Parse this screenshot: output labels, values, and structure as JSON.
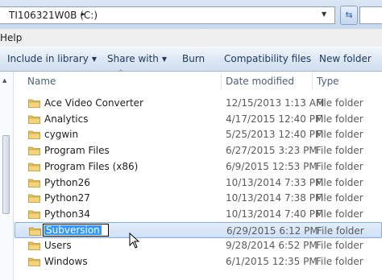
{
  "address": {
    "path": "TI106321W0B (C:)",
    "chevron": "▸"
  },
  "menubar": {
    "help": "Help"
  },
  "commands": {
    "include": "Include in library",
    "share": "Share with",
    "burn": "Burn",
    "compat": "Compatibility files",
    "newfolder": "New folder",
    "arrow": "▼"
  },
  "columns": {
    "name": "Name",
    "date": "Date modified",
    "type": "Type"
  },
  "rows": [
    {
      "name": "Ace Video Converter",
      "date": "12/15/2013 1:13 AM",
      "type": "File folder"
    },
    {
      "name": "Analytics",
      "date": "4/17/2015 12:40 PM",
      "type": "File folder"
    },
    {
      "name": "cygwin",
      "date": "5/25/2013 12:40 PM",
      "type": "File folder"
    },
    {
      "name": "Program Files",
      "date": "6/27/2015 3:23 PM",
      "type": "File folder"
    },
    {
      "name": "Program Files (x86)",
      "date": "6/9/2015 12:53 PM",
      "type": "File folder"
    },
    {
      "name": "Python26",
      "date": "10/13/2014 7:33 PM",
      "type": "File folder"
    },
    {
      "name": "Python27",
      "date": "10/13/2014 7:38 PM",
      "type": "File folder"
    },
    {
      "name": "Python34",
      "date": "10/13/2014 7:40 PM",
      "type": "File folder"
    },
    {
      "name": "Subversion",
      "date": "6/29/2015 6:12 PM",
      "type": "File folder",
      "selected": true
    },
    {
      "name": "Users",
      "date": "9/28/2014 6:52 PM",
      "type": "File folder"
    },
    {
      "name": "Windows",
      "date": "6/1/2015 12:35 PM",
      "type": "File folder"
    }
  ],
  "colors": {
    "selection": "#cfe0f7",
    "text_selection": "#3399ff",
    "folder": "#e8c15a"
  }
}
